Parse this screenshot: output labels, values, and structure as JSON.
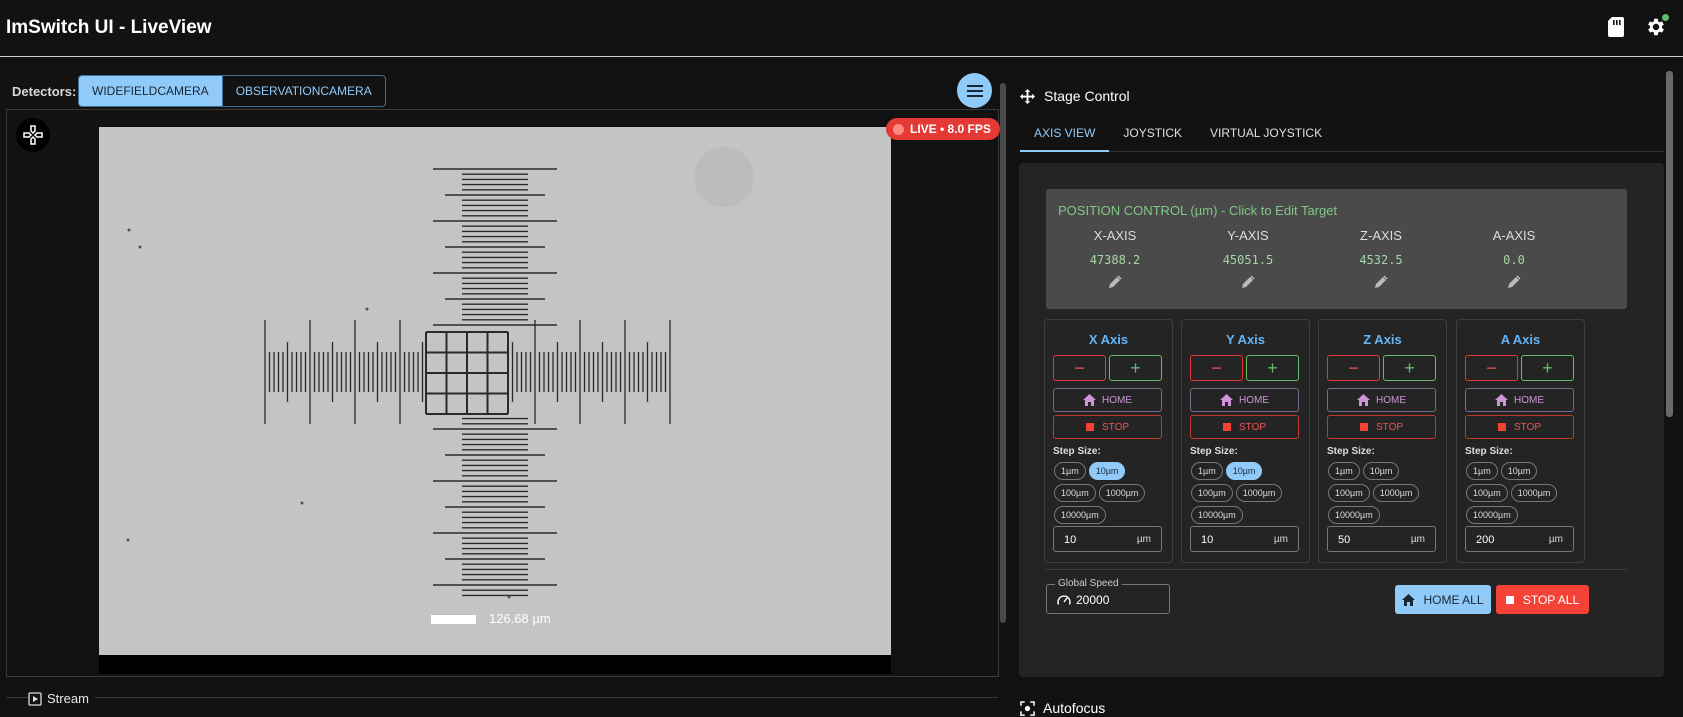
{
  "app": {
    "title": "ImSwitch UI - LiveView"
  },
  "header": {
    "storage_icon": "sd-card-icon",
    "settings_icon": "gear-icon",
    "status_color": "#66bb6a"
  },
  "detectors": {
    "label": "Detectors:",
    "items": [
      {
        "label": "WIDEFIELDCAMERA",
        "active": true
      },
      {
        "label": "OBSERVATIONCAMERA",
        "active": false
      }
    ]
  },
  "viewer": {
    "live_badge": "LIVE • 8.0 FPS",
    "scale_text": "126.68 µm",
    "stream_label": "Stream"
  },
  "stage": {
    "title": "Stage Control",
    "tabs": [
      {
        "label": "AXIS VIEW",
        "active": true
      },
      {
        "label": "JOYSTICK",
        "active": false
      },
      {
        "label": "VIRTUAL JOYSTICK",
        "active": false
      }
    ],
    "position": {
      "title": "POSITION CONTROL (µm) - Click to Edit Target",
      "axes": [
        {
          "name": "X-AXIS",
          "value": "47388.2"
        },
        {
          "name": "Y-AXIS",
          "value": "45051.5"
        },
        {
          "name": "Z-AXIS",
          "value": "4532.5"
        },
        {
          "name": "A-AXIS",
          "value": "0.0"
        }
      ]
    },
    "axis_cards": [
      {
        "title": "X Axis",
        "minus": "−",
        "plus": "+",
        "home": "HOME",
        "stop": "STOP",
        "step_label": "Step Size:",
        "chips": [
          "1µm",
          "10µm",
          "100µm",
          "1000µm",
          "10000µm"
        ],
        "active_chip": "10µm",
        "step_value": "10",
        "unit": "µm"
      },
      {
        "title": "Y Axis",
        "minus": "−",
        "plus": "+",
        "home": "HOME",
        "stop": "STOP",
        "step_label": "Step Size:",
        "chips": [
          "1µm",
          "10µm",
          "100µm",
          "1000µm",
          "10000µm"
        ],
        "active_chip": "10µm",
        "step_value": "10",
        "unit": "µm"
      },
      {
        "title": "Z Axis",
        "minus": "−",
        "plus": "+",
        "home": "HOME",
        "stop": "STOP",
        "step_label": "Step Size:",
        "chips": [
          "1µm",
          "10µm",
          "100µm",
          "1000µm",
          "10000µm"
        ],
        "active_chip": "",
        "step_value": "50",
        "unit": "µm"
      },
      {
        "title": "A Axis",
        "minus": "−",
        "plus": "+",
        "home": "HOME",
        "stop": "STOP",
        "step_label": "Step Size:",
        "chips": [
          "1µm",
          "10µm",
          "100µm",
          "1000µm",
          "10000µm"
        ],
        "active_chip": "",
        "step_value": "200",
        "unit": "µm"
      }
    ],
    "global_speed": {
      "label": "Global Speed",
      "value": "20000"
    },
    "home_all": "HOME ALL",
    "stop_all": "STOP ALL"
  },
  "autofocus": {
    "title": "Autofocus"
  },
  "colors": {
    "accent": "#90caf9",
    "danger": "#f44336",
    "success": "#66bb6a",
    "home": "#ce93d8"
  }
}
